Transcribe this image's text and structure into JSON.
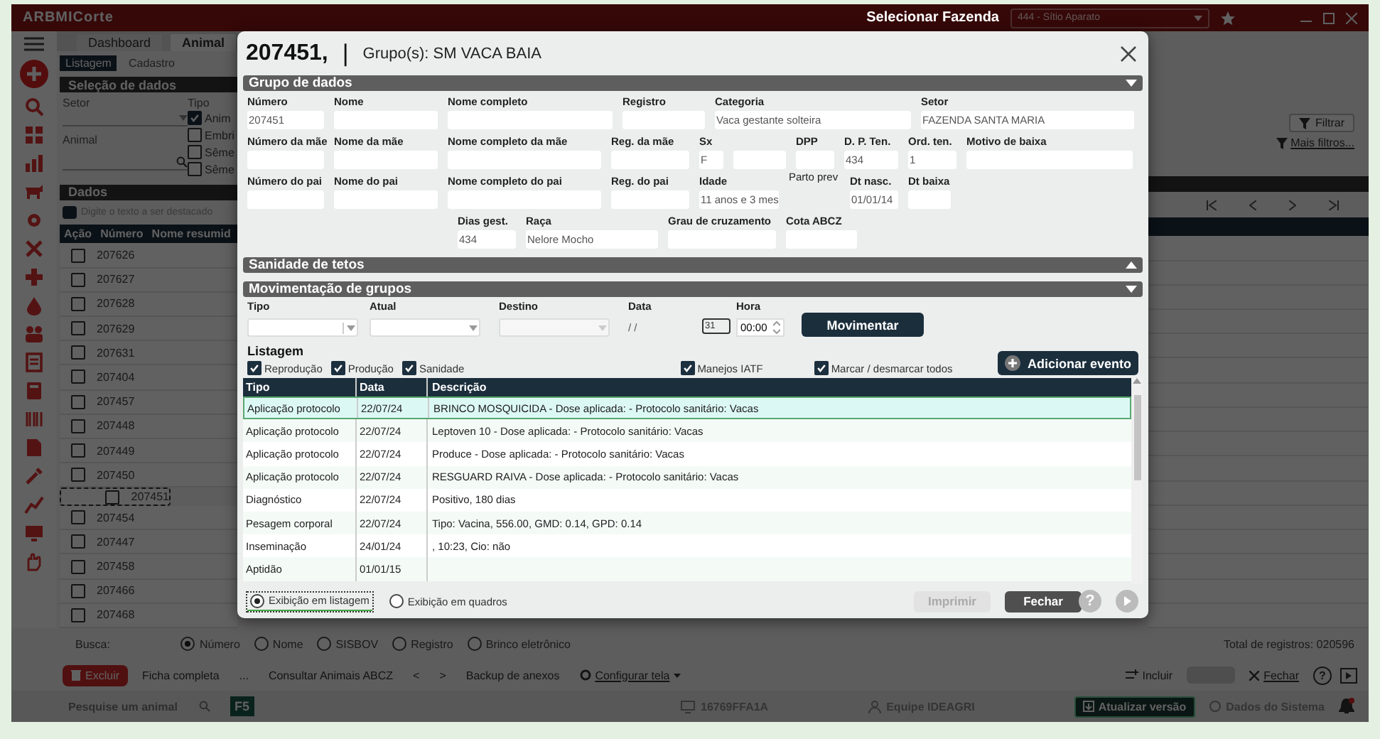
{
  "app": {
    "title": "ARBMICorte",
    "farm_label": "Selecionar Fazenda",
    "farm_value": "444 - Sítio Aparato",
    "main_tabs": [
      {
        "label": "Dashboard",
        "selected": false
      },
      {
        "label": "Animal",
        "selected": true
      }
    ],
    "sub_tabs": [
      {
        "label": "Listagem",
        "selected": true
      },
      {
        "label": "Cadastro",
        "selected": false
      }
    ],
    "selection_title": "Seleção de dados",
    "setor_label": "Setor",
    "tipo_label": "Tipo",
    "tipo_options": [
      {
        "label": "Anim",
        "checked": true
      },
      {
        "label": "Embri",
        "checked": false
      },
      {
        "label": "Sême",
        "checked": false
      },
      {
        "label": "Sême",
        "checked": false
      }
    ],
    "animal_label": "Animal",
    "filter_button": "Filtrar",
    "more_filters": "Mais filtros...",
    "data_title": "Dados",
    "highlight_placeholder": "Digite o texto a ser destacado",
    "columns": [
      "Ação",
      "Número",
      "Nome resumid"
    ],
    "rows": [
      {
        "number": "207626",
        "checked": false,
        "selected": false
      },
      {
        "number": "207627",
        "checked": false,
        "selected": false
      },
      {
        "number": "207628",
        "checked": false,
        "selected": false
      },
      {
        "number": "207629",
        "checked": false,
        "selected": false
      },
      {
        "number": "207631",
        "checked": false,
        "selected": false
      },
      {
        "number": "207404",
        "checked": false,
        "selected": false
      },
      {
        "number": "207457",
        "checked": false,
        "selected": false
      },
      {
        "number": "207448",
        "checked": false,
        "selected": false
      },
      {
        "number": "207449",
        "checked": false,
        "selected": false
      },
      {
        "number": "207450",
        "checked": false,
        "selected": false
      },
      {
        "number": "207451",
        "checked": false,
        "selected": true
      },
      {
        "number": "207454",
        "checked": false,
        "selected": false
      },
      {
        "number": "207447",
        "checked": false,
        "selected": false
      },
      {
        "number": "207458",
        "checked": false,
        "selected": false
      },
      {
        "number": "207466",
        "checked": false,
        "selected": false
      },
      {
        "number": "207468",
        "checked": false,
        "selected": false
      }
    ],
    "search_label": "Busca:",
    "search_options": [
      {
        "label": "Número",
        "selected": true
      },
      {
        "label": "Nome",
        "selected": false
      },
      {
        "label": "SISBOV",
        "selected": false
      },
      {
        "label": "Registro",
        "selected": false
      },
      {
        "label": "Brinco eletrônico",
        "selected": false
      }
    ],
    "total": "Total de registros: 020596",
    "toolbar_left": [
      "Excluir",
      "Ficha completa",
      "...",
      "Consultar Animais ABCZ",
      "<",
      ">",
      "Backup de anexos",
      "Configurar tela"
    ],
    "toolbar_right": {
      "add": "Incluir",
      "close": "Fechar",
      "help": "?"
    },
    "status": {
      "search_placeholder": "Pesquise um animal",
      "key": "F5",
      "machine": "16769FFA1A",
      "team": "Equipe IDEAGRI",
      "update": "Atualizar versão",
      "system": "Dados do Sistema"
    }
  },
  "dialog": {
    "number": "207451,",
    "separator": "|",
    "groups": "Grupo(s): SM VACA BAIA",
    "data_section": {
      "title": "Grupo de dados",
      "expanded": true,
      "fields": [
        {
          "label": "Número",
          "value": "207451"
        },
        {
          "label": "Nome"
        },
        {
          "label": "Nome completo"
        },
        {
          "label": "Registro"
        },
        {
          "label": "Categoria",
          "value": "Vaca gestante solteira"
        },
        {
          "label": "Setor",
          "value": "FAZENDA SANTA MARIA"
        },
        {
          "label": "Número da mãe"
        },
        {
          "label": "Nome da mãe"
        },
        {
          "label": "Nome completo da mãe"
        },
        {
          "label": "Reg. da mãe"
        },
        {
          "label": "Sx",
          "value": "F"
        },
        {
          "kind": "blank"
        },
        {
          "label": "DPP"
        },
        {
          "label": "D. P. Ten.",
          "value": "434"
        },
        {
          "label": "Ord. ten.",
          "value": "1"
        },
        {
          "label": "Motivo de baixa"
        },
        {
          "label": "Número do pai"
        },
        {
          "label": "Nome do pai"
        },
        {
          "label": "Nome completo do pai"
        },
        {
          "label": "Reg. do pai"
        },
        {
          "label": "Idade",
          "value": "11 anos e 3 mes"
        },
        {
          "label": "Parto prev",
          "kind": "label"
        },
        {
          "label": "Dt nasc.",
          "value": "01/01/14"
        },
        {
          "label": "Dt baixa"
        },
        {
          "label": "Dias gest.",
          "value": "434"
        },
        {
          "label": "Raça",
          "value": "Nelore Mocho"
        },
        {
          "label": "Grau de cruzamento"
        },
        {
          "label": "Cota ABCZ"
        }
      ]
    },
    "teats_section": {
      "title": "Sanidade de tetos",
      "expanded": false
    },
    "move_section": {
      "title": "Movimentação de grupos",
      "expanded": true,
      "type_label": "Tipo",
      "current_label": "Atual",
      "target_label": "Destino",
      "target_disabled": true,
      "date_label": "Data",
      "date_value": "/ /",
      "calendar": "31",
      "time_label": "Hora",
      "time_value": "00:00",
      "button": "Movimentar"
    },
    "listing": {
      "title": "Listagem",
      "filters": [
        {
          "label": "Reprodução",
          "checked": true
        },
        {
          "label": "Produção",
          "checked": true
        },
        {
          "label": "Sanidade",
          "checked": true
        },
        {
          "label": "Manejos IATF",
          "checked": true
        },
        {
          "label": "Marcar / desmarcar todos",
          "checked": true
        }
      ],
      "add_button": "Adicionar evento",
      "columns": [
        "Tipo",
        "Data",
        "Descrição"
      ],
      "rows": [
        {
          "type": "Aplicação protocolo",
          "date": "22/07/24",
          "description": "BRINCO MOSQUICIDA -  Dose aplicada:  -  Protocolo sanitário: Vacas",
          "selected": true
        },
        {
          "type": "Aplicação protocolo",
          "date": "22/07/24",
          "description": "Leptoven 10 -  Dose aplicada:  -  Protocolo sanitário: Vacas",
          "selected": false
        },
        {
          "type": "Aplicação protocolo",
          "date": "22/07/24",
          "description": "Produce -  Dose aplicada:  -  Protocolo sanitário: Vacas",
          "selected": false
        },
        {
          "type": "Aplicação protocolo",
          "date": "22/07/24",
          "description": "RESGUARD RAIVA -  Dose aplicada:  -  Protocolo sanitário: Vacas",
          "selected": false
        },
        {
          "type": "Diagnóstico",
          "date": "22/07/24",
          "description": "Positivo, 180 dias",
          "selected": false
        },
        {
          "type": "Pesagem corporal",
          "date": "22/07/24",
          "description": "Tipo: Vacina, 556.00, GMD: 0.14, GPD: 0.14",
          "selected": false
        },
        {
          "type": "Inseminação",
          "date": "24/01/24",
          "description": ", 10:23, Cio: não",
          "selected": false
        },
        {
          "type": "Aptidão",
          "date": "01/01/15",
          "selected": false
        }
      ]
    },
    "views": [
      {
        "label": "Exibição em listagem",
        "selected": true
      },
      {
        "label": "Exibição em quadros",
        "selected": false
      }
    ],
    "print_button": {
      "label": "Imprimir",
      "disabled": true
    },
    "close_button": "Fechar",
    "help": "?"
  }
}
